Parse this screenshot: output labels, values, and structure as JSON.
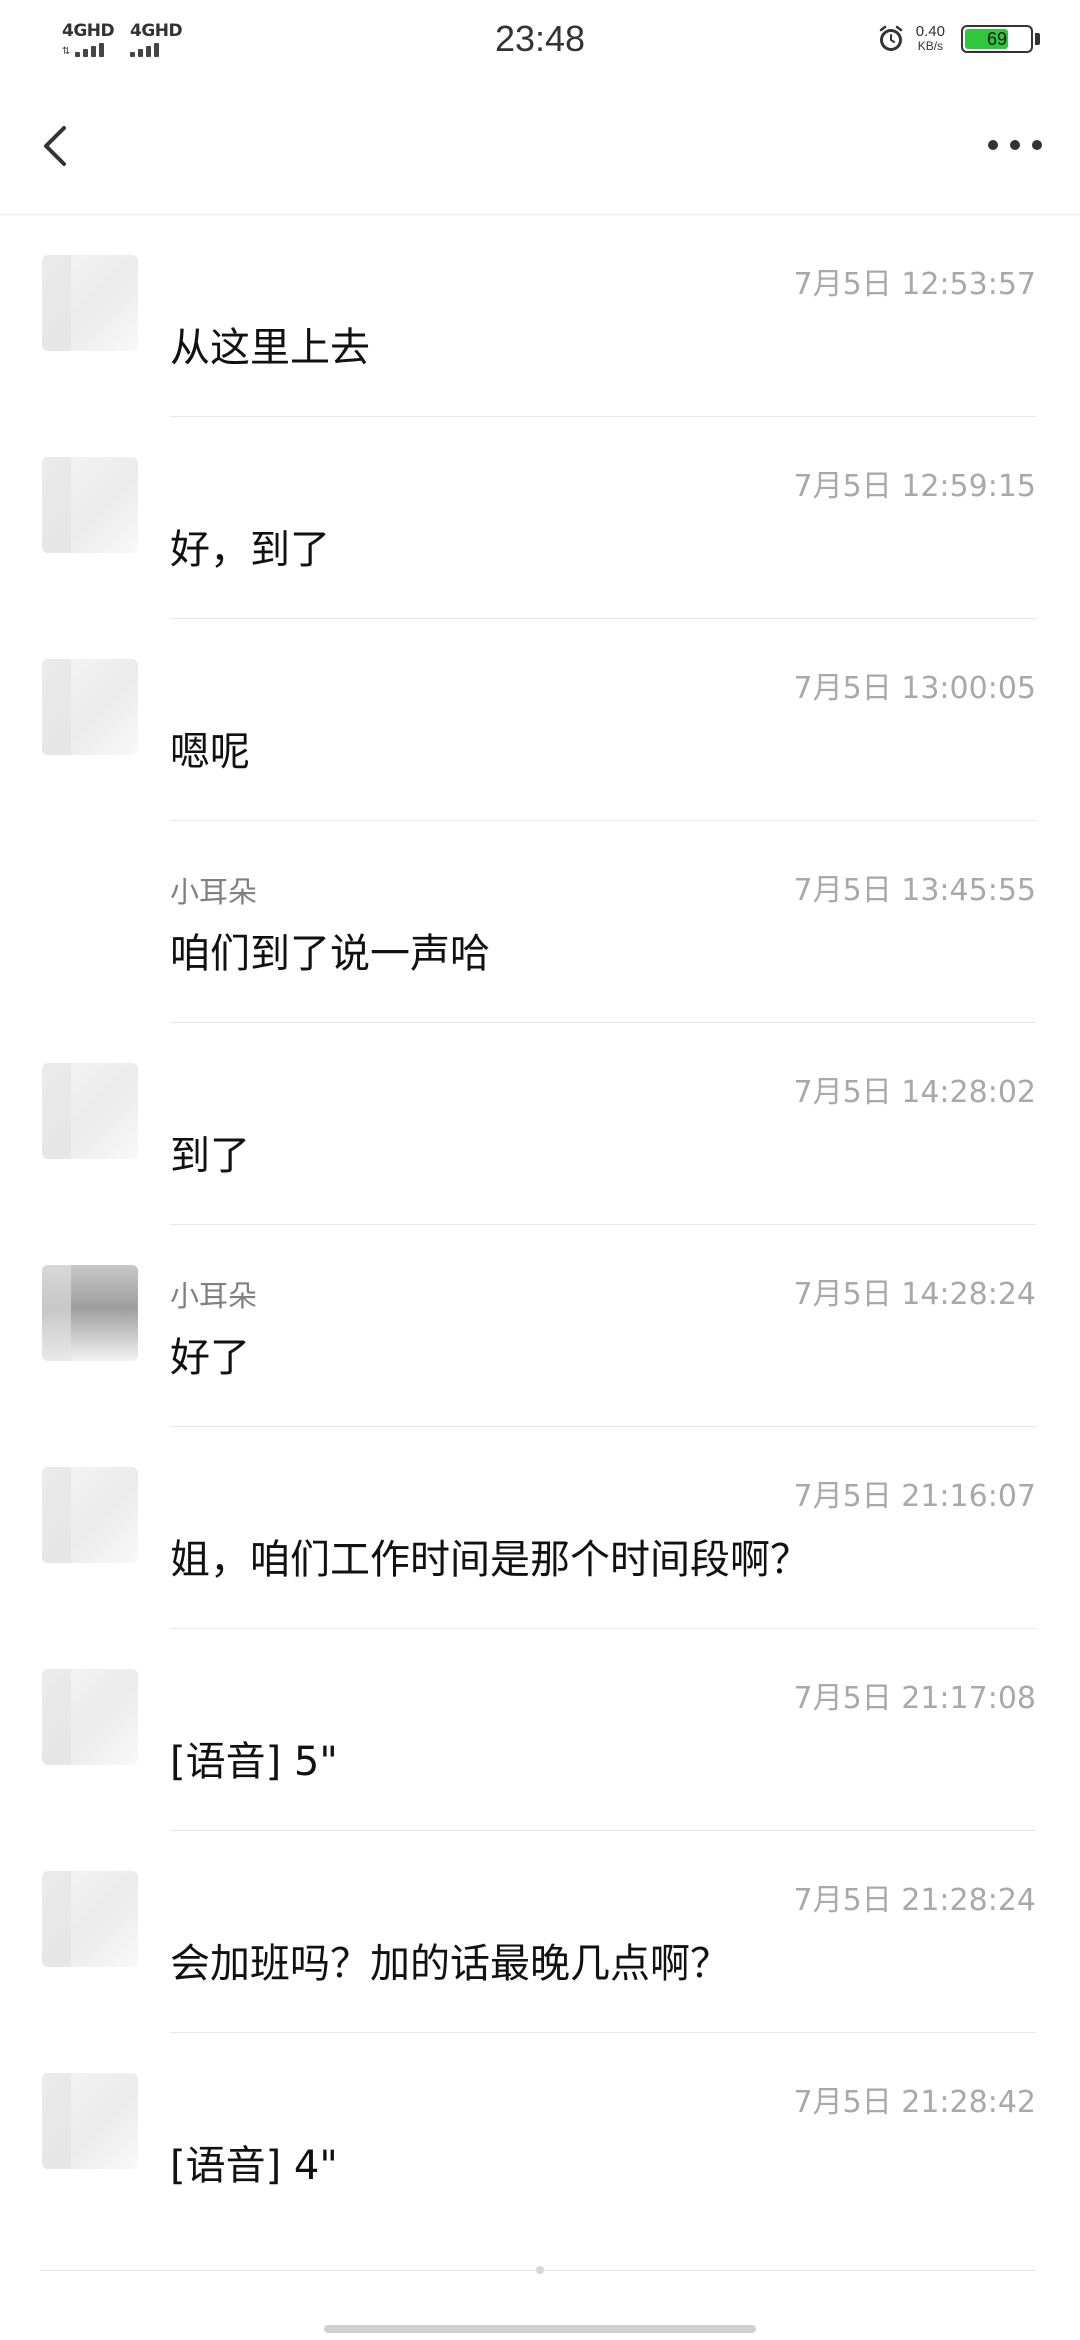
{
  "status_bar": {
    "signal_1": "4GHD",
    "signal_2": "4GHD",
    "time": "23:48",
    "speed_value": "0.40",
    "speed_unit": "KB/s",
    "battery_level": "69",
    "battery_fraction": 0.69,
    "battery_color": "#2ec73d",
    "alarm_icon": "alarm-clock-icon"
  },
  "nav": {
    "back_icon": "chevron-left-icon",
    "more_icon": "more-dots-icon"
  },
  "messages": [
    {
      "sender": "",
      "time": "7月5日 12:53:57",
      "content": "从这里上去"
    },
    {
      "sender": "",
      "time": "7月5日 12:59:15",
      "content": "好，到了"
    },
    {
      "sender": "",
      "time": "7月5日 13:00:05",
      "content": "嗯呢"
    },
    {
      "sender": "小耳朵",
      "time": "7月5日 13:45:55",
      "content": "咱们到了说一声哈"
    },
    {
      "sender": "",
      "time": "7月5日 14:28:02",
      "content": "到了"
    },
    {
      "sender": "小耳朵",
      "time": "7月5日 14:28:24",
      "content": "好了"
    },
    {
      "sender": "",
      "time": "7月5日 21:16:07",
      "content": "姐，咱们工作时间是那个时间段啊？"
    },
    {
      "sender": "",
      "time": "7月5日 21:17:08",
      "content": "[语音] 5\""
    },
    {
      "sender": "",
      "time": "7月5日 21:28:24",
      "content": "会加班吗？加的话最晚几点啊？"
    },
    {
      "sender": "",
      "time": "7月5日 21:28:42",
      "content": "[语音] 4\""
    }
  ]
}
